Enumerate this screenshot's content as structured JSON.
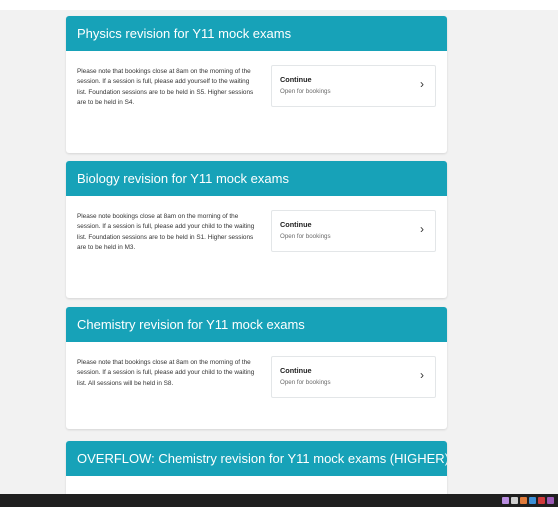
{
  "cards": [
    {
      "title": "Physics revision for Y11 mock exams",
      "note": "Please note that bookings close at 8am on the morning of the session. If a session is full, please add yourself to the waiting list. Foundation sessions are to be held in S5. Higher sessions are to be held in S4.",
      "option": {
        "label": "Continue",
        "status": "Open for bookings"
      }
    },
    {
      "title": "Biology revision for Y11 mock exams",
      "note": "Please note bookings close at 8am on the morning of the session. If a session is full, please add your child to the waiting list. Foundation sessions are to be held in S1. Higher sessions are to be held in M3.",
      "option": {
        "label": "Continue",
        "status": "Open for bookings"
      }
    },
    {
      "title": "Chemistry revision for Y11 mock exams",
      "note": "Please note that bookings close at 8am on the morning of the session. If a session is full, please add your child to the waiting list. All sessions will be held in S8.",
      "option": {
        "label": "Continue",
        "status": "Open for bookings"
      }
    },
    {
      "title": "OVERFLOW: Chemistry revision for Y11 mock exams (HIGHER)"
    }
  ],
  "icons": {
    "chevron": "chevron-right-icon"
  },
  "colors": {
    "header": "#17a2b8",
    "page_background": "#f2f2f2",
    "taskbar": "#1f1f1f"
  }
}
